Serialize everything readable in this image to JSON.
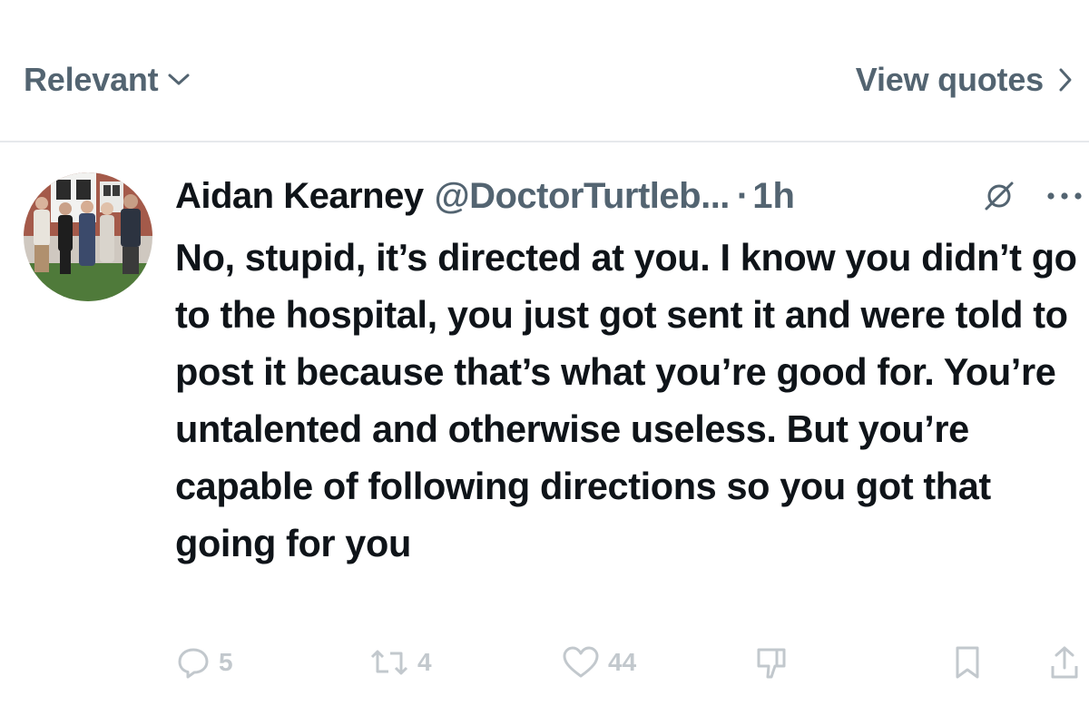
{
  "top_bar": {
    "sort_label": "Relevant",
    "view_quotes_label": "View quotes"
  },
  "tweet": {
    "author_name": "Aidan Kearney",
    "handle": "@DoctorTurtleb...",
    "separator": "·",
    "time": "1h",
    "text": "No, stupid, it’s directed at you. I know you didn’t go to the hospital, you just got sent it and were told to post it because that’s what you’re good for. You’re untalented and otherwise useless. But you’re capable of following directions so you got that going for you",
    "reply_count": "5",
    "repost_count": "4",
    "like_count": "44"
  },
  "icons": {
    "sort": "chevron-down-icon",
    "quotes": "chevron-right-icon",
    "grok": "grok-icon",
    "more": "more-icon",
    "reply": "reply-icon",
    "repost": "repost-icon",
    "like": "like-icon",
    "dislike": "dislike-icon",
    "bookmark": "bookmark-icon",
    "share": "share-icon"
  },
  "colors": {
    "primary_text": "#0f1419",
    "secondary_text": "#536471",
    "divider": "#e6e9ec"
  }
}
